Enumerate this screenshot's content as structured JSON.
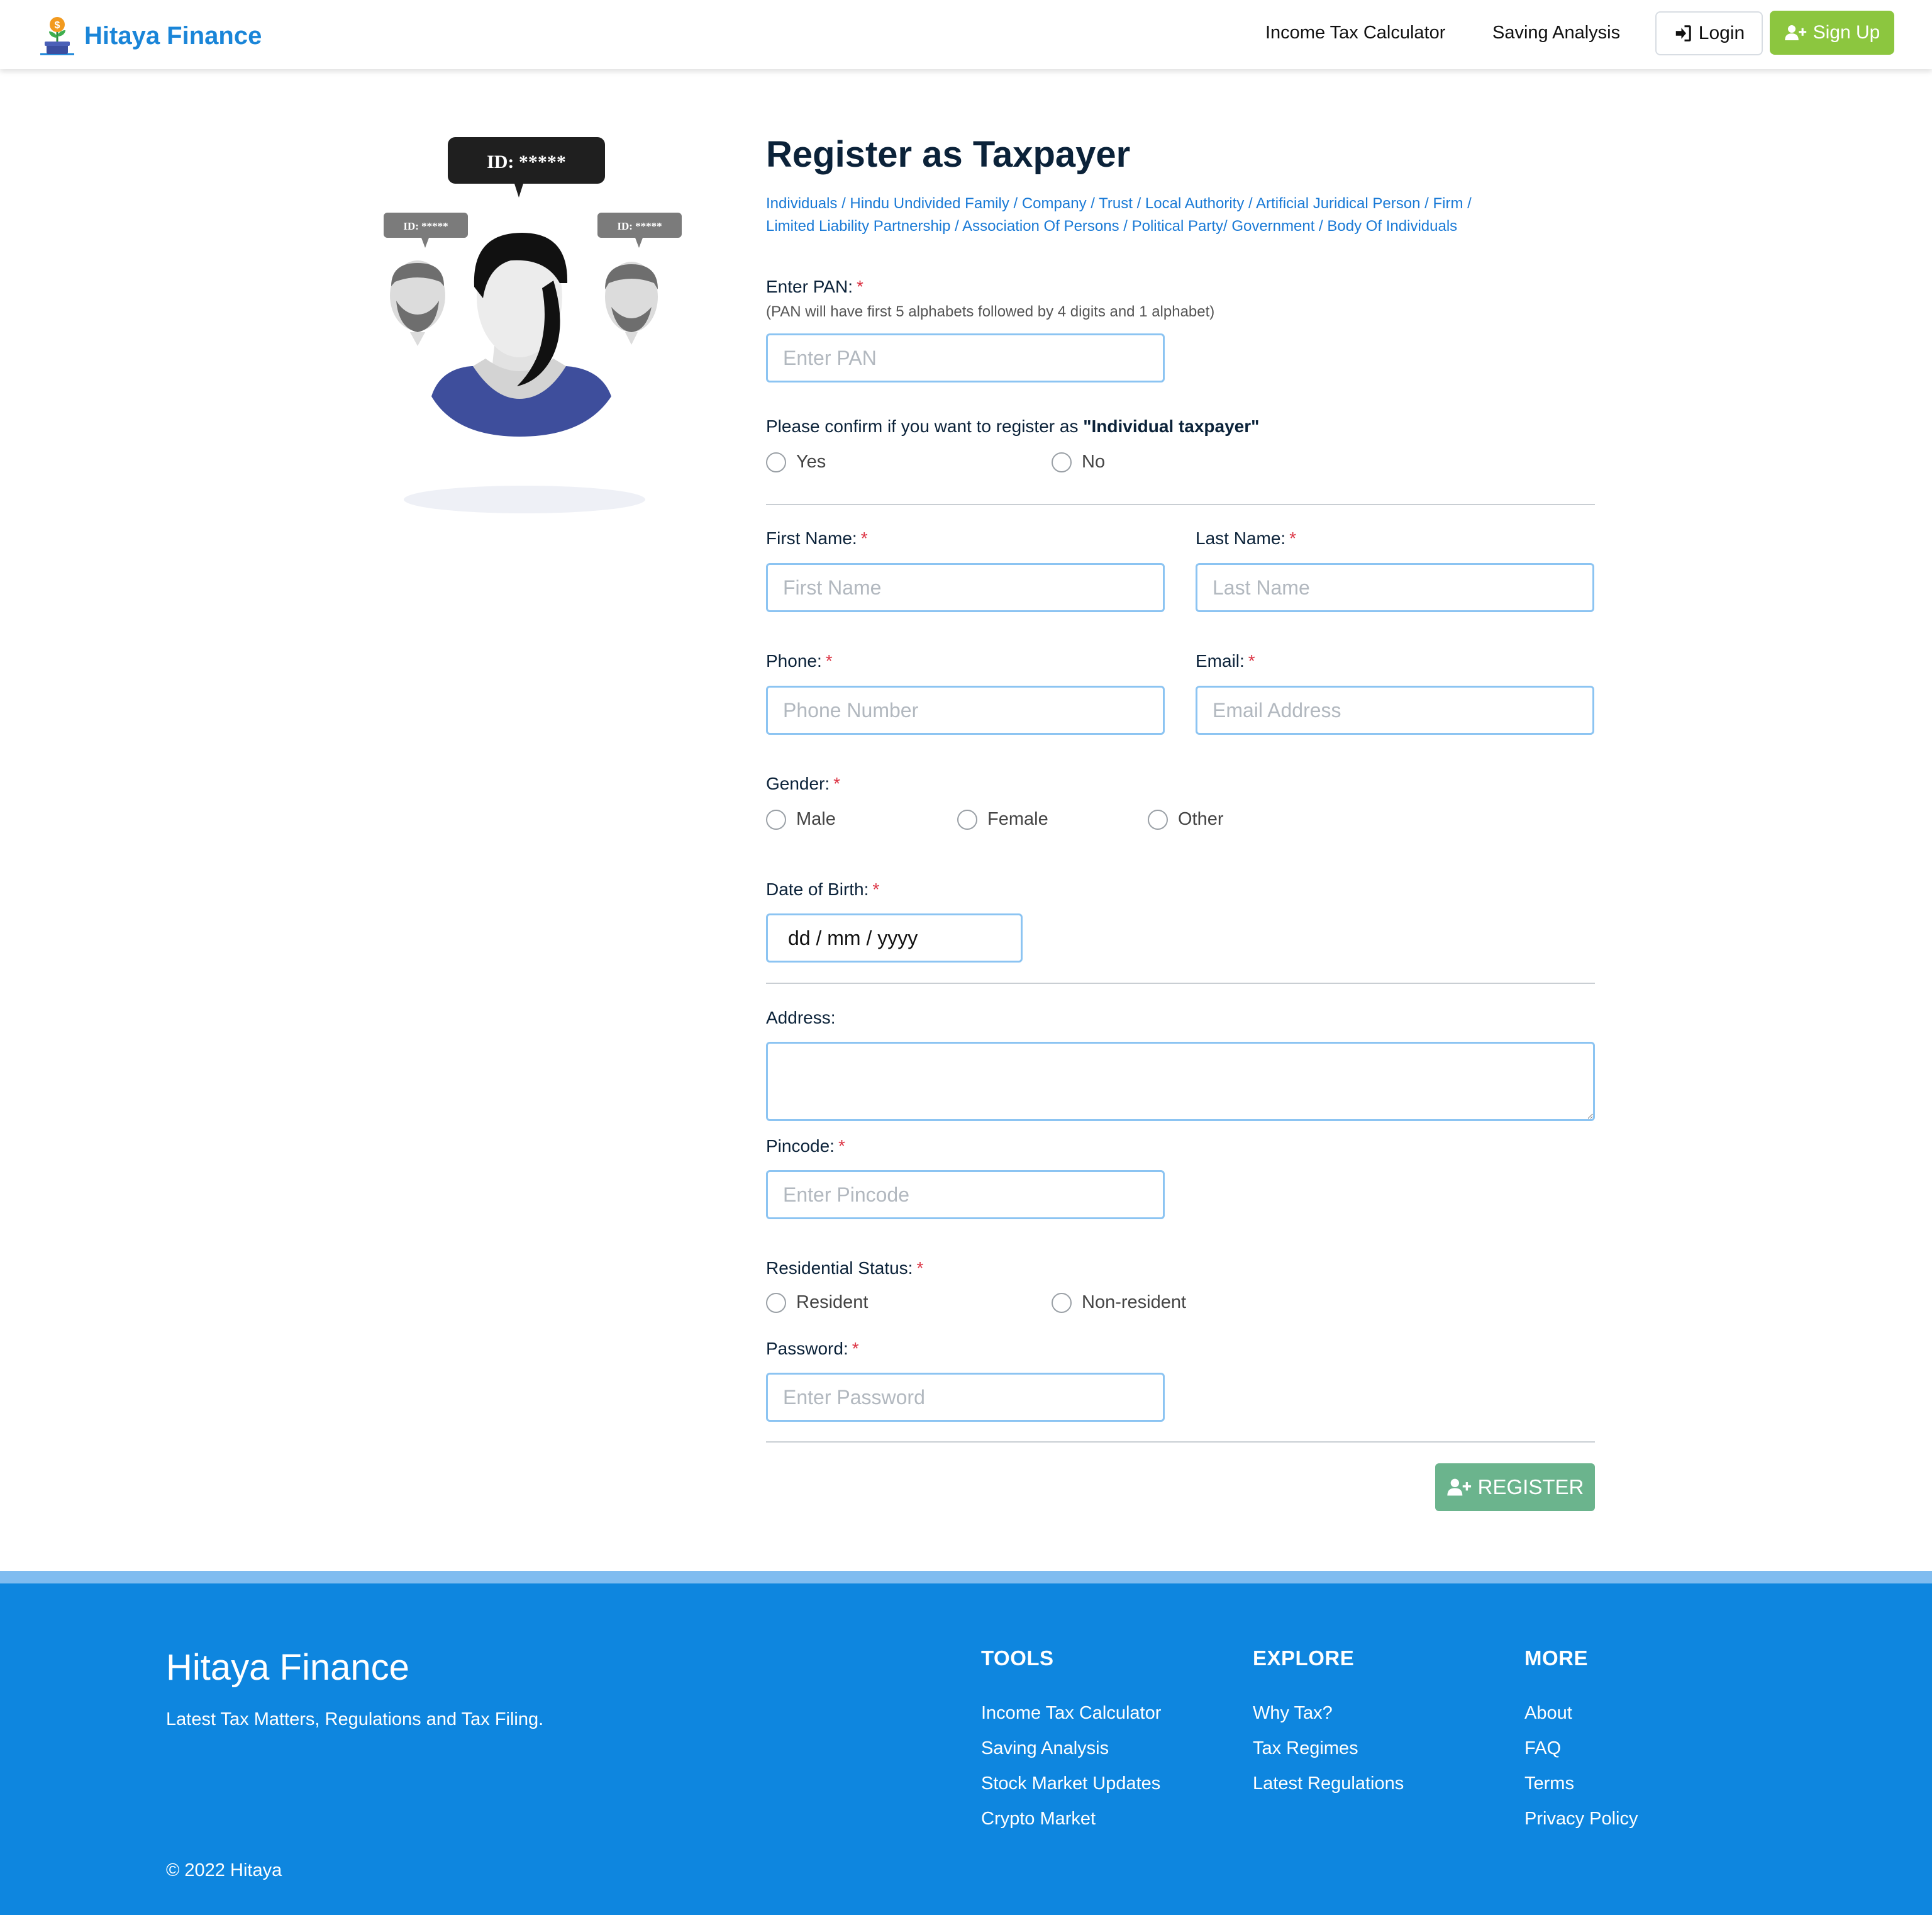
{
  "nav": {
    "brand": "Hitaya Finance",
    "links": [
      "Income Tax Calculator",
      "Saving Analysis"
    ],
    "login": "Login",
    "signup": "Sign Up"
  },
  "illustration": {
    "bubble_main": "ID: *****",
    "bubble_left": "ID: *****",
    "bubble_right": "ID: *****"
  },
  "form": {
    "title": "Register as Taxpayer",
    "categories_line1": "Individuals / Hindu Undivided Family / Company / Trust / Local Authority / Artificial Juridical Person / Firm /",
    "categories_line2": "Limited Liability Partnership / Association Of Persons / Political Party/ Government / Body Of Individuals",
    "pan": {
      "label": "Enter PAN:",
      "hint": "(PAN will have first 5 alphabets followed by 4 digits and 1 alphabet)",
      "placeholder": "Enter PAN"
    },
    "confirm": {
      "label_prefix": "Please confirm if you want to register as ",
      "label_bold": "\"Individual taxpayer\"",
      "options": [
        "Yes",
        "No"
      ]
    },
    "first_name": {
      "label": "First Name:",
      "placeholder": "First Name"
    },
    "last_name": {
      "label": "Last Name:",
      "placeholder": "Last Name"
    },
    "phone": {
      "label": "Phone:",
      "placeholder": "Phone Number"
    },
    "email": {
      "label": "Email:",
      "placeholder": "Email Address"
    },
    "gender": {
      "label": "Gender:",
      "options": [
        "Male",
        "Female",
        "Other"
      ]
    },
    "dob": {
      "label": "Date of Birth:",
      "value": "dd / mm / yyyy"
    },
    "address": {
      "label": "Address:"
    },
    "pincode": {
      "label": "Pincode:",
      "placeholder": "Enter Pincode"
    },
    "residential": {
      "label": "Residential Status:",
      "options": [
        "Resident",
        "Non-resident"
      ]
    },
    "password": {
      "label": "Password:",
      "placeholder": "Enter Password"
    },
    "required_mark": "*",
    "register": "REGISTER"
  },
  "footer": {
    "brand": "Hitaya Finance",
    "tagline": "Latest Tax Matters, Regulations and Tax Filing.",
    "copyright": "© 2022 Hitaya",
    "tools": {
      "heading": "TOOLS",
      "links": [
        "Income Tax Calculator",
        "Saving Analysis",
        "Stock Market Updates",
        "Crypto Market"
      ]
    },
    "explore": {
      "heading": "EXPLORE",
      "links": [
        "Why Tax?",
        "Tax Regimes",
        "Latest Regulations"
      ]
    },
    "more": {
      "heading": "MORE",
      "links": [
        "About",
        "FAQ",
        "Terms",
        "Privacy Policy"
      ]
    }
  },
  "colors": {
    "brand": "#1a85d8",
    "signup": "#8cc63f",
    "register": "#6bb48d",
    "footer": "#0e86df",
    "required": "#dc3545"
  }
}
